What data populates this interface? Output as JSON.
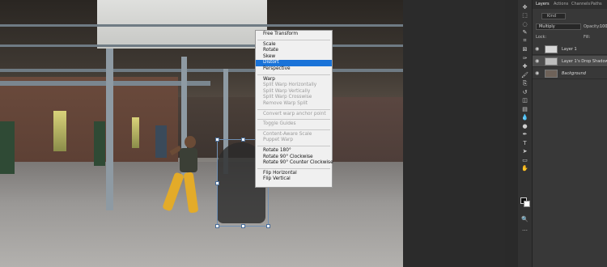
{
  "context_menu": {
    "items": [
      {
        "label": "Free Transform",
        "state": "enabled"
      },
      {
        "sep": true
      },
      {
        "label": "Scale",
        "state": "enabled"
      },
      {
        "label": "Rotate",
        "state": "enabled"
      },
      {
        "label": "Skew",
        "state": "enabled"
      },
      {
        "label": "Distort",
        "state": "selected"
      },
      {
        "label": "Perspective",
        "state": "enabled"
      },
      {
        "sep": true
      },
      {
        "label": "Warp",
        "state": "enabled"
      },
      {
        "label": "Split Warp Horizontally",
        "state": "disabled"
      },
      {
        "label": "Split Warp Vertically",
        "state": "disabled"
      },
      {
        "label": "Split Warp Crosswise",
        "state": "disabled"
      },
      {
        "label": "Remove Warp Split",
        "state": "disabled"
      },
      {
        "sep": true
      },
      {
        "label": "Convert warp anchor point",
        "state": "disabled"
      },
      {
        "sep": true
      },
      {
        "label": "Toggle Guides",
        "state": "disabled"
      },
      {
        "sep": true
      },
      {
        "label": "Content-Aware Scale",
        "state": "disabled"
      },
      {
        "label": "Puppet Warp",
        "state": "disabled"
      },
      {
        "sep": true
      },
      {
        "label": "Rotate 180°",
        "state": "enabled"
      },
      {
        "label": "Rotate 90° Clockwise",
        "state": "enabled"
      },
      {
        "label": "Rotate 90° Counter Clockwise",
        "state": "enabled"
      },
      {
        "sep": true
      },
      {
        "label": "Flip Horizontal",
        "state": "enabled"
      },
      {
        "label": "Flip Vertical",
        "state": "enabled"
      }
    ]
  },
  "panel": {
    "tabs": [
      "Layers",
      "Actions",
      "Channels",
      "Paths"
    ],
    "active_tab": "Layers",
    "kind_filter": "Kind",
    "blend_mode": "Multiply",
    "opacity_label": "Opacity:",
    "opacity_value": "100",
    "lock_label": "Lock:",
    "fill_label": "Fill:",
    "layers": [
      {
        "name": "Layer 1",
        "italic": false,
        "selected": false,
        "thumb": "#d8d8d8"
      },
      {
        "name": "Layer 1's Drop Shadow",
        "italic": false,
        "selected": true,
        "thumb": "#bdbdbd"
      },
      {
        "name": "Background",
        "italic": true,
        "selected": false,
        "thumb": "#6e6259"
      }
    ]
  },
  "toolbar": {
    "tools": [
      "move-icon",
      "marquee-icon",
      "lasso-icon",
      "quick-select-icon",
      "crop-icon",
      "frame-icon",
      "eyedropper-icon",
      "healing-icon",
      "brush-icon",
      "clone-stamp-icon",
      "history-brush-icon",
      "eraser-icon",
      "gradient-icon",
      "blur-icon",
      "dodge-icon",
      "pen-icon",
      "type-icon",
      "path-select-icon",
      "shape-icon",
      "hand-icon",
      "zoom-icon",
      "more-icon"
    ],
    "glyphs": [
      "✥",
      "⬚",
      "◌",
      "✎",
      "⌗",
      "⊠",
      "✑",
      "✚",
      "🖌",
      "⎘",
      "↺",
      "◫",
      "▤",
      "💧",
      "●",
      "✒",
      "T",
      "➤",
      "▭",
      "✋",
      "🔍",
      "…"
    ],
    "foreground": "#0b0b0b",
    "background": "#ffffff"
  }
}
